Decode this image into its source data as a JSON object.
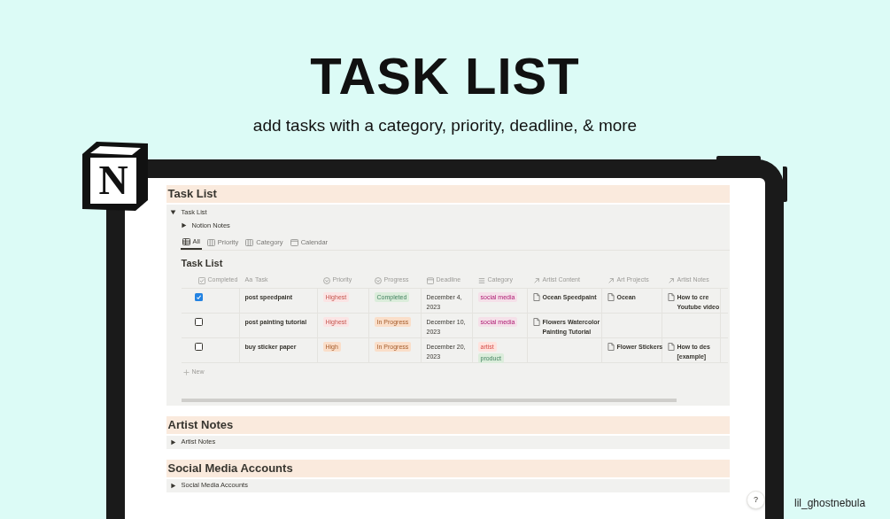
{
  "headline": "TASK LIST",
  "subtitle": "add tasks with a category, priority, deadline, & more",
  "logo": {
    "letter": "N"
  },
  "task_section": {
    "heading": "Task List",
    "toggle": {
      "label": "Task List",
      "expanded": true
    },
    "sub_toggle": {
      "label": "Notion Notes",
      "expanded": false
    },
    "views": [
      {
        "label": "All",
        "kind": "table",
        "selected": true
      },
      {
        "label": "Priority",
        "kind": "board",
        "selected": false
      },
      {
        "label": "Category",
        "kind": "board",
        "selected": false
      },
      {
        "label": "Calendar",
        "kind": "calendar",
        "selected": false
      }
    ],
    "table": {
      "title": "Task List",
      "columns": [
        {
          "label": "Completed",
          "kind": "checkbox"
        },
        {
          "label": "Task",
          "kind": "title",
          "prefix": "Aa"
        },
        {
          "label": "Priority",
          "kind": "select"
        },
        {
          "label": "Progress",
          "kind": "status"
        },
        {
          "label": "Deadline",
          "kind": "date"
        },
        {
          "label": "Category",
          "kind": "multi"
        },
        {
          "label": "Artist Content",
          "kind": "relation"
        },
        {
          "label": "Art Projects",
          "kind": "relation"
        },
        {
          "label": "Artist Notes",
          "kind": "relation"
        }
      ],
      "rows": [
        {
          "completed": true,
          "task": "post speedpaint",
          "priority": {
            "label": "Highest",
            "color": "#fbe4e4"
          },
          "progress": {
            "label": "Completed",
            "color": "#dbeddb"
          },
          "deadline": "December 4,\n2023",
          "categories": [
            {
              "label": "social media",
              "color": "#f5e0e9"
            }
          ],
          "artist_content": "Ocean Speedpaint",
          "art_projects": "Ocean",
          "artist_notes": "How to cre\nYoutube video"
        },
        {
          "completed": false,
          "task": "post painting tutorial",
          "priority": {
            "label": "Highest",
            "color": "#fbe4e4"
          },
          "progress": {
            "label": "In Progress",
            "color": "#fadec9"
          },
          "deadline": "December 10,\n2023",
          "categories": [
            {
              "label": "social media",
              "color": "#f5e0e9"
            }
          ],
          "artist_content": "Flowers Watercolor\nPainting Tutorial"
        },
        {
          "completed": false,
          "task": "buy sticker paper",
          "priority": {
            "label": "High",
            "color": "#fadec9"
          },
          "progress": {
            "label": "In Progress",
            "color": "#fadec9"
          },
          "deadline": "December 20,\n2023",
          "categories": [
            {
              "label": "artist",
              "color": "#ffe2dd"
            },
            {
              "label": "product",
              "color": "#dbeddb"
            }
          ],
          "art_projects": "Flower Stickers",
          "artist_notes": "How to des\n[example]"
        }
      ],
      "new_row": "New"
    }
  },
  "other_sections": [
    {
      "heading": "Artist Notes",
      "toggle": {
        "label": "Artist Notes",
        "expanded": false
      }
    },
    {
      "heading": "Social Media Accounts",
      "toggle": {
        "label": "Social Media Accounts",
        "expanded": false
      }
    }
  ],
  "help_button": "?",
  "credit": "lil_ghostnebula"
}
